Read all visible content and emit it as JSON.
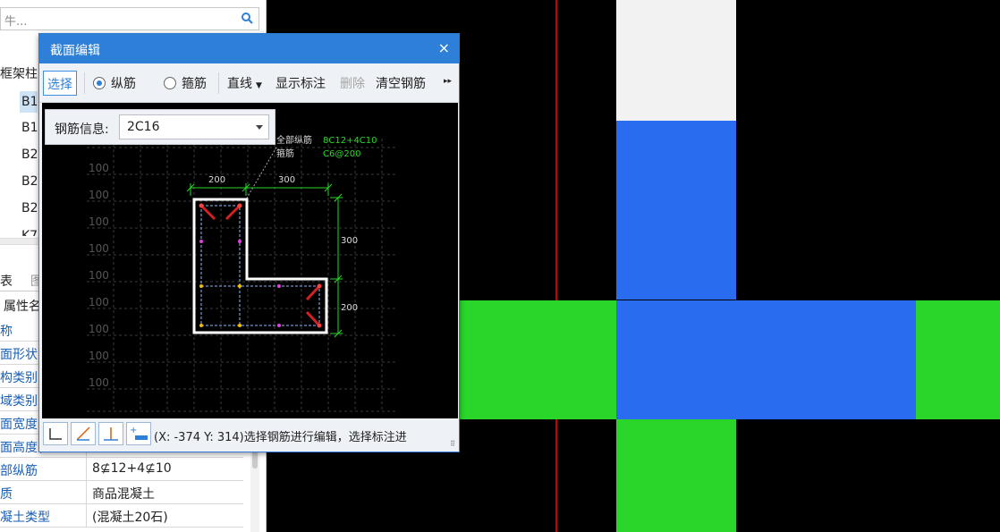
{
  "left_panel": {
    "search_placeholder": "牛...",
    "group_label": "框架柱",
    "tree_items": [
      "B1",
      "B1",
      "B2",
      "B2",
      "B2",
      "K7"
    ],
    "tabs": [
      "表",
      "图"
    ],
    "prop_header": "属性名",
    "properties": [
      {
        "name": "称",
        "value": ""
      },
      {
        "name": "面形状",
        "value": ""
      },
      {
        "name": "构类别",
        "value": ""
      },
      {
        "name": "域类别",
        "value": ""
      },
      {
        "name": "面宽度(",
        "value": ""
      },
      {
        "name": "面高度(",
        "value": ""
      },
      {
        "name": "部纵筋",
        "value": "8⊈12+4⊈10"
      },
      {
        "name": "质",
        "value": "商品混凝土"
      },
      {
        "name": "凝土类型",
        "value": "(混凝土20石)"
      }
    ]
  },
  "dialog": {
    "title": "截面编辑",
    "close": "×",
    "toolbar": {
      "select": "选择",
      "longitudinal": "纵筋",
      "stirrup": "箍筋",
      "line": "直线",
      "show_annotation": "显示标注",
      "delete": "删除",
      "clear_rebar": "清空钢筋",
      "more": "▸▸"
    },
    "rebar_info_label": "钢筋信息:",
    "rebar_info_value": "2C16",
    "drawing": {
      "legend_all_long": "全部纵筋",
      "legend_all_long_val": "8C12+4C10",
      "legend_stirrup": "箍筋",
      "legend_stirrup_val": "C6@200",
      "dim_200_top": "200",
      "dim_300_top": "300",
      "dim_300_right": "300",
      "dim_200_right": "200",
      "grid_label": "100"
    },
    "status_text": "(X: -374 Y: 314)选择钢筋进行编辑，选择标注进"
  },
  "colors": {
    "accent": "#2e7fd8",
    "canvas_blue": "#2a6cf0",
    "canvas_green": "#2ad62a",
    "canvas_white": "#f2f2f2",
    "red_line": "#cc0000"
  }
}
